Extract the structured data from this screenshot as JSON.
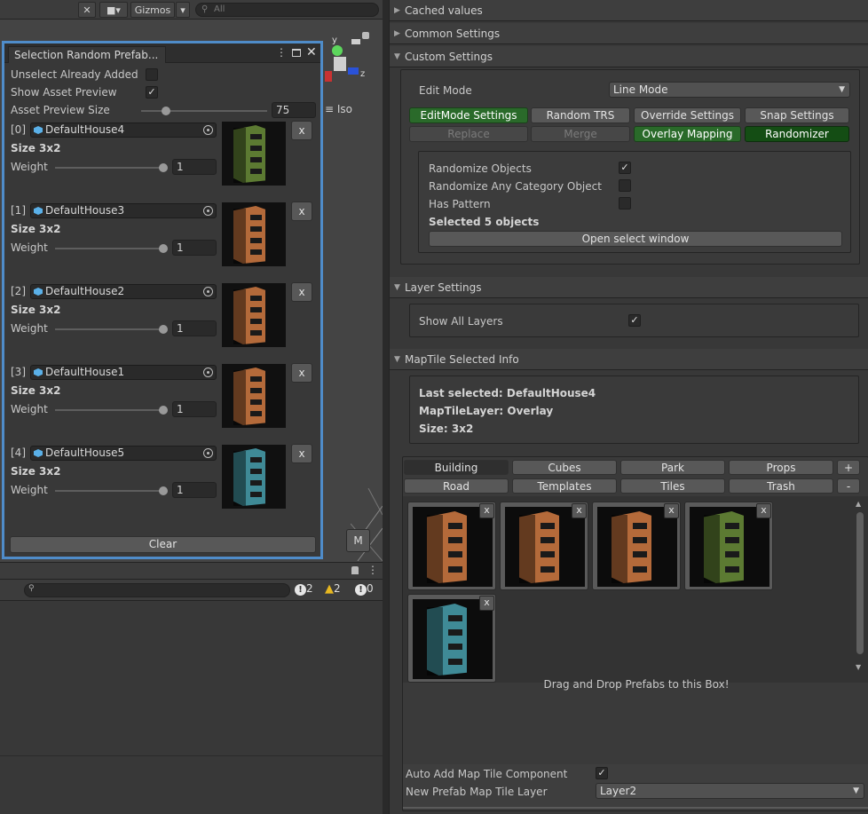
{
  "scene_toolbar": {
    "gizmos_label": "Gizmos",
    "search_placeholder": "All",
    "iso_label": "Iso",
    "m_label": "M",
    "axis_y": "y",
    "axis_z": "z"
  },
  "selection_window": {
    "tab_title": "Selection Random Prefab...",
    "unselect_label": "Unselect Already Added",
    "unselect_checked": "",
    "show_preview_label": "Show Asset Preview",
    "show_preview_checked": "✓",
    "preview_size_label": "Asset Preview Size",
    "preview_size_value": "75",
    "items": [
      {
        "index": "[0]",
        "name": "DefaultHouse4",
        "size": "Size 3x2",
        "weight_label": "Weight",
        "weight": "1",
        "x": "x"
      },
      {
        "index": "[1]",
        "name": "DefaultHouse3",
        "size": "Size 3x2",
        "weight_label": "Weight",
        "weight": "1",
        "x": "x"
      },
      {
        "index": "[2]",
        "name": "DefaultHouse2",
        "size": "Size 3x2",
        "weight_label": "Weight",
        "weight": "1",
        "x": "x"
      },
      {
        "index": "[3]",
        "name": "DefaultHouse1",
        "size": "Size 3x2",
        "weight_label": "Weight",
        "weight": "1",
        "x": "x"
      },
      {
        "index": "[4]",
        "name": "DefaultHouse5",
        "size": "Size 3x2",
        "weight_label": "Weight",
        "weight": "1",
        "x": "x"
      }
    ],
    "clear_label": "Clear"
  },
  "console": {
    "errors": "2",
    "warnings": "2",
    "infos": "0"
  },
  "inspector": {
    "cached_values": "Cached values",
    "common_settings": "Common Settings",
    "custom_settings": "Custom Settings",
    "edit_mode_label": "Edit Mode",
    "edit_mode_value": "Line Mode",
    "buttons_row1": [
      "EditMode Settings",
      "Random TRS",
      "Override Settings",
      "Snap Settings"
    ],
    "buttons_row2": [
      "Replace",
      "Merge",
      "Overlay Mapping",
      "Randomizer"
    ],
    "randomize_objects": "Randomize Objects",
    "randomize_any": "Randomize Any Category Object",
    "has_pattern": "Has Pattern",
    "selected_count": "Selected 5 objects",
    "open_select_window": "Open select window",
    "layer_settings": "Layer Settings",
    "show_all_layers": "Show All Layers",
    "maptile_info": "MapTile Selected Info",
    "last_selected": "Last selected: DefaultHouse4",
    "maptile_layer": "MapTileLayer: Overlay",
    "size": "Size: 3x2",
    "categories_row1": [
      "Building",
      "Cubes",
      "Park",
      "Props"
    ],
    "categories_row2": [
      "Road",
      "Templates",
      "Tiles",
      "Trash"
    ],
    "plus": "+",
    "minus": "-",
    "thumb_x": "x",
    "drop_hint": "Drag and Drop Prefabs to this Box!",
    "auto_add_label": "Auto Add Map Tile Component",
    "new_layer_label": "New Prefab Map Tile Layer",
    "new_layer_value": "Layer2"
  },
  "colors": {
    "selection_border": "#4f8cc9",
    "green_button": "#2a6a2a",
    "house_green": "#5c7a32",
    "house_orange": "#b46a3a",
    "house_teal": "#3f8a96"
  }
}
